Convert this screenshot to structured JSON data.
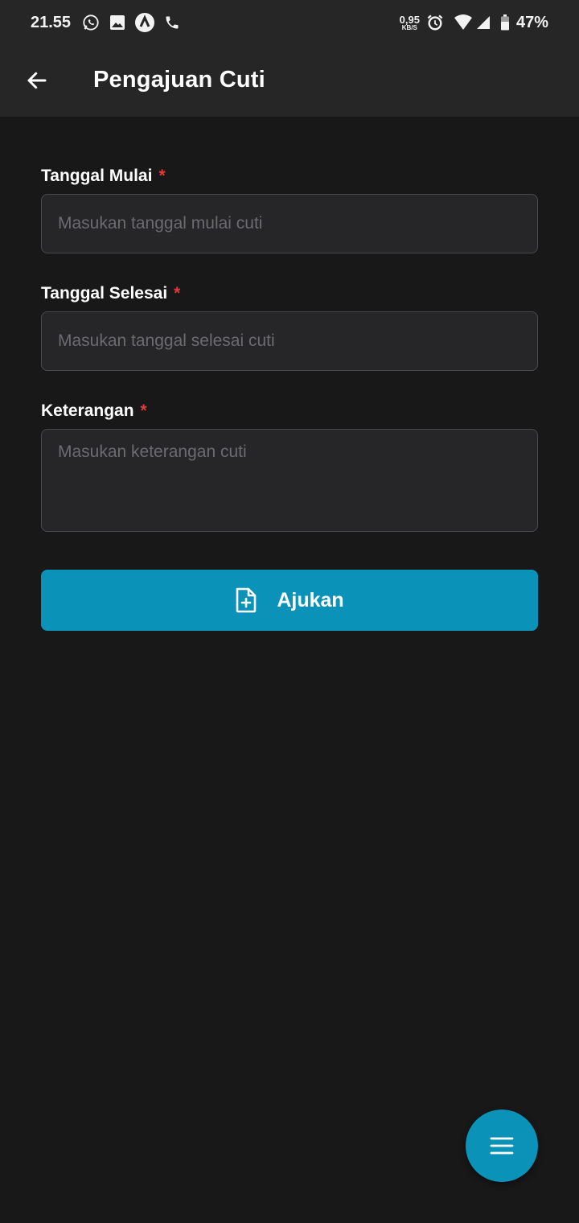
{
  "status_bar": {
    "time": "21.55",
    "net_speed_value": "0,95",
    "net_speed_unit": "KB/S",
    "battery": "47%",
    "icons": [
      "whatsapp-icon",
      "gallery-icon",
      "app-a-icon",
      "phone-icon",
      "alarm-icon",
      "wifi-icon",
      "signal-icon",
      "battery-icon"
    ]
  },
  "app_bar": {
    "title": "Pengajuan Cuti",
    "back_icon": "arrow-left-icon"
  },
  "form": {
    "start_date": {
      "label": "Tanggal Mulai",
      "required_mark": "*",
      "placeholder": "Masukan tanggal mulai cuti",
      "value": ""
    },
    "end_date": {
      "label": "Tanggal Selesai",
      "required_mark": "*",
      "placeholder": "Masukan tanggal selesai cuti",
      "value": ""
    },
    "notes": {
      "label": "Keterangan",
      "required_mark": "*",
      "placeholder": "Masukan keterangan cuti",
      "value": ""
    },
    "submit": {
      "label": "Ajukan",
      "icon": "file-plus-icon"
    }
  },
  "fab": {
    "icon": "menu-icon"
  },
  "colors": {
    "background": "#181819",
    "bar": "#262627",
    "accent": "#0b92b8",
    "required": "#e53935",
    "input_bg": "#262628",
    "input_border": "#4a4a4d",
    "placeholder": "#6c6c70"
  }
}
